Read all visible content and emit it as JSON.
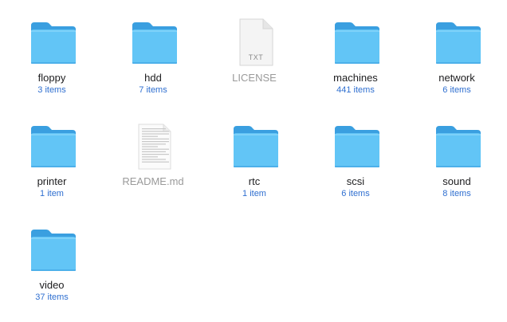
{
  "items": [
    {
      "name": "floppy",
      "count": "3 items",
      "kind": "folder",
      "icon": "folder-icon"
    },
    {
      "name": "hdd",
      "count": "7 items",
      "kind": "folder",
      "icon": "folder-icon"
    },
    {
      "name": "LICENSE",
      "count": "",
      "kind": "txt",
      "icon": "text-document-icon",
      "badge": "TXT"
    },
    {
      "name": "machines",
      "count": "441 items",
      "kind": "folder",
      "icon": "folder-icon"
    },
    {
      "name": "network",
      "count": "6 items",
      "kind": "folder",
      "icon": "folder-icon"
    },
    {
      "name": "printer",
      "count": "1 item",
      "kind": "folder",
      "icon": "folder-icon"
    },
    {
      "name": "README.md",
      "count": "",
      "kind": "md",
      "icon": "markdown-document-icon"
    },
    {
      "name": "rtc",
      "count": "1 item",
      "kind": "folder",
      "icon": "folder-icon"
    },
    {
      "name": "scsi",
      "count": "6 items",
      "kind": "folder",
      "icon": "folder-icon"
    },
    {
      "name": "sound",
      "count": "8 items",
      "kind": "folder",
      "icon": "folder-icon"
    },
    {
      "name": "video",
      "count": "37 items",
      "kind": "folder",
      "icon": "folder-icon"
    }
  ],
  "colors": {
    "folder_back": "#3a9fe0",
    "folder_front": "#62c5f6",
    "folder_highlight": "#8fd8fb",
    "count_text": "#2f6fd0",
    "dim_label": "#9a9a9a"
  }
}
